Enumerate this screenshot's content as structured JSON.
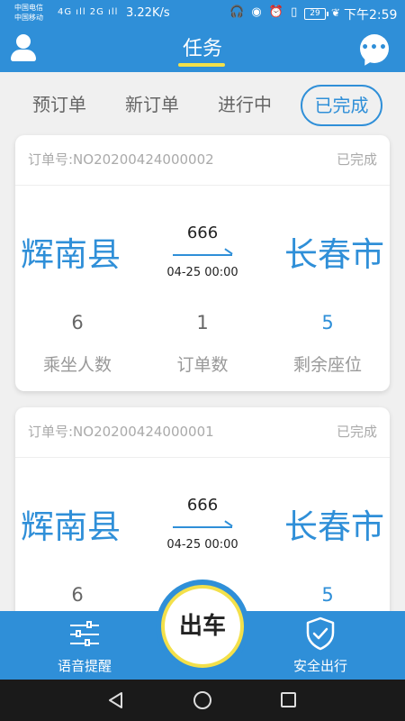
{
  "status_bar": {
    "carrier_1": "中国电信",
    "carrier_2": "中国移动",
    "network": "4G ıll 2G ıll",
    "speed": "3.22K/s",
    "battery": "29",
    "time": "下午2:59"
  },
  "header": {
    "title": "任务",
    "accent_color": "#2f8fd8",
    "underline_color": "#f3e04a"
  },
  "tabs": [
    {
      "label": "预订单",
      "active": false
    },
    {
      "label": "新订单",
      "active": false
    },
    {
      "label": "进行中",
      "active": false
    },
    {
      "label": "已完成",
      "active": true
    }
  ],
  "orders": [
    {
      "order_label": "订单号:NO20200424000002",
      "status": "已完成",
      "from": "辉南县",
      "to": "长春市",
      "route_no": "666",
      "depart_time": "04-25 00:00",
      "stats": [
        {
          "value": "6",
          "label": "乘坐人数"
        },
        {
          "value": "1",
          "label": "订单数"
        },
        {
          "value": "5",
          "label": "剩余座位"
        }
      ]
    },
    {
      "order_label": "订单号:NO20200424000001",
      "status": "已完成",
      "from": "辉南县",
      "to": "长春市",
      "route_no": "666",
      "depart_time": "04-25 00:00",
      "stats": [
        {
          "value": "6",
          "label": ""
        },
        {
          "value": "",
          "label": ""
        },
        {
          "value": "5",
          "label": ""
        }
      ]
    }
  ],
  "bottom_bar": {
    "voice_label": "语音提醒",
    "depart_label": "出车",
    "safety_label": "安全出行"
  },
  "icons": {
    "user": "user-icon",
    "chat": "chat-bubble-icon",
    "voice": "sliders-icon",
    "safety": "shield-check-icon"
  }
}
